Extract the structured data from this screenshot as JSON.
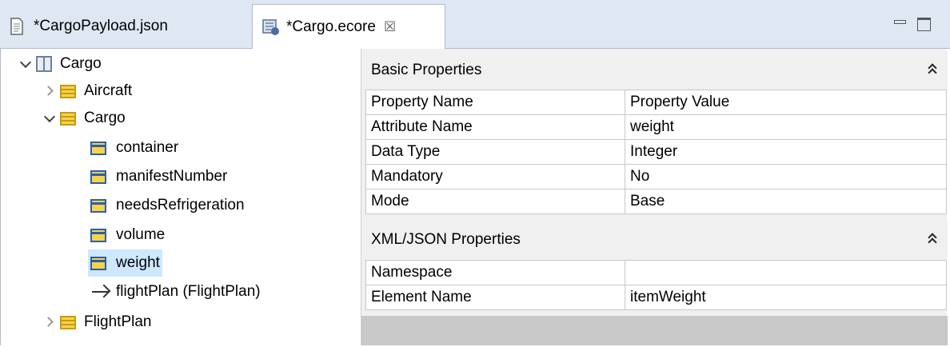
{
  "tabs": [
    {
      "label": "*CargoPayload.json",
      "active": false,
      "icon": "json-file-icon"
    },
    {
      "label": "*Cargo.ecore",
      "active": true,
      "icon": "ecore-model-icon",
      "close_glyph": "☒"
    }
  ],
  "tree": {
    "root": {
      "label": "Cargo",
      "icon": "package-icon",
      "expanded": true
    },
    "classes": [
      {
        "label": "Aircraft",
        "expanded": false
      },
      {
        "label": "Cargo",
        "expanded": true,
        "attributes": [
          "container",
          "manifestNumber",
          "needsRefrigeration",
          "volume",
          "weight"
        ],
        "reference": "flightPlan (FlightPlan)"
      },
      {
        "label": "FlightPlan",
        "expanded": false
      }
    ],
    "selected": "weight"
  },
  "basic_properties": {
    "title": "Basic Properties",
    "columns": [
      "Property Name",
      "Property Value"
    ],
    "rows": [
      [
        "Attribute Name",
        "weight"
      ],
      [
        "Data Type",
        "Integer"
      ],
      [
        "Mandatory",
        "No"
      ],
      [
        "Mode",
        "Base"
      ]
    ]
  },
  "xml_json_properties": {
    "title": "XML/JSON Properties",
    "rows": [
      [
        "Namespace",
        ""
      ],
      [
        "Element Name",
        "itemWeight"
      ]
    ]
  },
  "colors": {
    "tabbar_bg": "#dfe7f3",
    "selection_bg": "#cde8ff",
    "class_icon": "#f6d44a"
  }
}
